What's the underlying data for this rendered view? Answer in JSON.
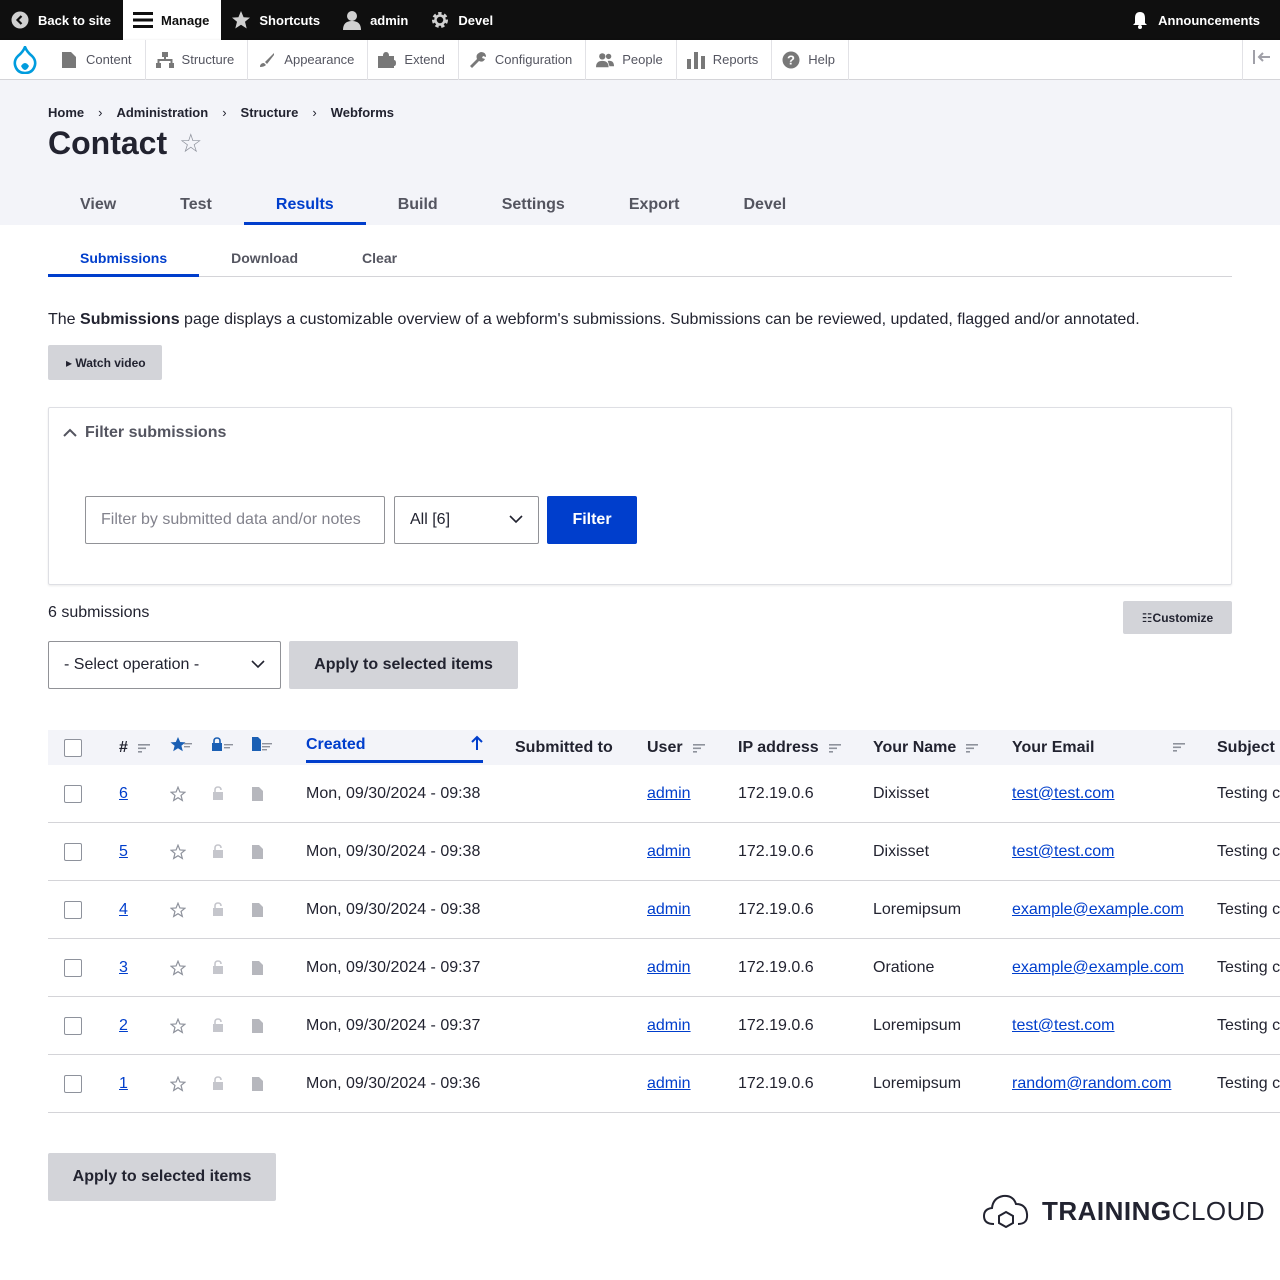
{
  "toolbar": {
    "back_to_site": "Back to site",
    "manage": "Manage",
    "shortcuts": "Shortcuts",
    "user": "admin",
    "devel": "Devel",
    "announcements": "Announcements"
  },
  "tray": {
    "items": [
      "Content",
      "Structure",
      "Appearance",
      "Extend",
      "Configuration",
      "People",
      "Reports",
      "Help"
    ]
  },
  "breadcrumb": [
    "Home",
    "Administration",
    "Structure",
    "Webforms"
  ],
  "page": {
    "title": "Contact",
    "star": "☆"
  },
  "primary_tabs": [
    "View",
    "Test",
    "Results",
    "Build",
    "Settings",
    "Export",
    "Devel"
  ],
  "secondary_tabs": [
    "Submissions",
    "Download",
    "Clear"
  ],
  "intro": {
    "prefix": "The ",
    "bold": "Submissions",
    "suffix": " page displays a customizable overview of a webform's submissions. Submissions can be reviewed, updated, flagged and/or annotated."
  },
  "watch_video": "▸ Watch video",
  "filter": {
    "summary": "Filter submissions",
    "placeholder": "Filter by submitted data and/or notes",
    "state_value": "All [6]",
    "button": "Filter"
  },
  "results": {
    "count": "6 submissions",
    "customize": "☷Customize",
    "operation_placeholder": "- Select operation -",
    "apply": "Apply to selected items"
  },
  "table": {
    "headers": {
      "sid": "#",
      "created": "Created",
      "submitted_to": "Submitted to",
      "user": "User",
      "ip": "IP address",
      "name": "Your Name",
      "email": "Your Email",
      "subject": "Subject"
    },
    "rows": [
      {
        "sid": "6",
        "created": "Mon, 09/30/2024 - 09:38",
        "user": "admin",
        "ip": "172.19.0.6",
        "name": "Dixisset",
        "email": "test@test.com",
        "subject": "Testing c"
      },
      {
        "sid": "5",
        "created": "Mon, 09/30/2024 - 09:38",
        "user": "admin",
        "ip": "172.19.0.6",
        "name": "Dixisset",
        "email": "test@test.com",
        "subject": "Testing c"
      },
      {
        "sid": "4",
        "created": "Mon, 09/30/2024 - 09:38",
        "user": "admin",
        "ip": "172.19.0.6",
        "name": "Loremipsum",
        "email": "example@example.com",
        "subject": "Testing c"
      },
      {
        "sid": "3",
        "created": "Mon, 09/30/2024 - 09:37",
        "user": "admin",
        "ip": "172.19.0.6",
        "name": "Oratione",
        "email": "example@example.com",
        "subject": "Testing c"
      },
      {
        "sid": "2",
        "created": "Mon, 09/30/2024 - 09:37",
        "user": "admin",
        "ip": "172.19.0.6",
        "name": "Loremipsum",
        "email": "test@test.com",
        "subject": "Testing c"
      },
      {
        "sid": "1",
        "created": "Mon, 09/30/2024 - 09:36",
        "user": "admin",
        "ip": "172.19.0.6",
        "name": "Loremipsum",
        "email": "random@random.com",
        "subject": "Testing c"
      }
    ]
  },
  "logo": {
    "bold": "TRAINING",
    "light": "CLOUD"
  },
  "colors": {
    "accent": "#003ecc",
    "toolbar": "#0f0f0f",
    "header_bg": "#f3f4f9"
  }
}
